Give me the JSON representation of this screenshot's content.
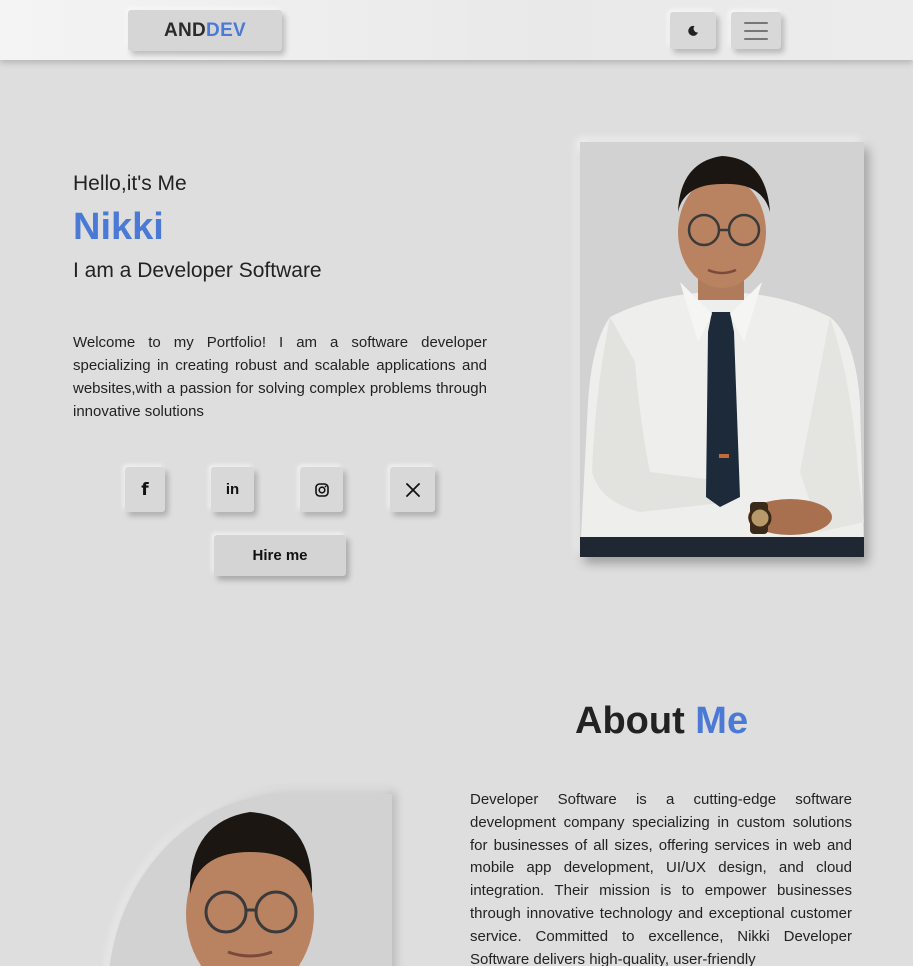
{
  "header": {
    "logo_part1": "AND",
    "logo_part2": "DEV",
    "theme_icon": "moon-icon",
    "menu_icon": "hamburger-menu-icon"
  },
  "hero": {
    "greeting": "Hello,it's Me",
    "name": "Nikki",
    "role": "I am a Developer Software",
    "intro": "Welcome to my Portfolio! I am a software developer specializing in creating robust and scalable applications and websites,with a passion for solving complex problems through innovative solutions",
    "social": [
      {
        "icon": "facebook-icon",
        "glyph": "f"
      },
      {
        "icon": "linkedin-icon",
        "glyph": "in"
      },
      {
        "icon": "instagram-icon"
      },
      {
        "icon": "x-twitter-icon"
      }
    ],
    "hire_label": "Hire me"
  },
  "about": {
    "title_part1": "About ",
    "title_part2": "Me",
    "text": "Developer Software is a cutting-edge software development company specializing in custom solutions for businesses of all sizes, offering services in web and mobile app development, UI/UX design, and cloud integration. Their mission is to empower businesses through innovative technology and exceptional customer service. Committed to excellence, Nikki Developer Software delivers high-quality, user-friendly"
  },
  "colors": {
    "accent": "#4a7ad6",
    "background": "#dedede"
  }
}
